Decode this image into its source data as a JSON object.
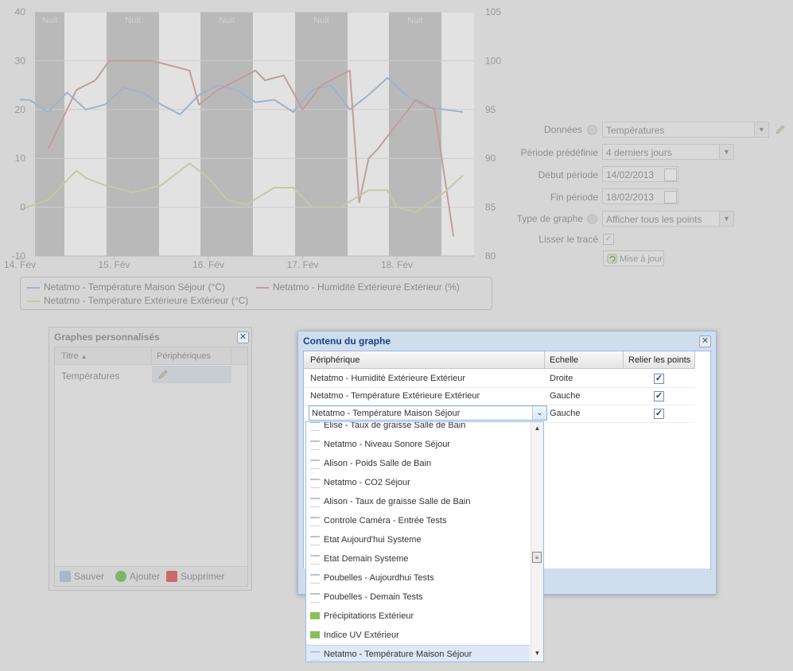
{
  "chart": {
    "left_axis_ticks": [
      "40",
      "30",
      "20",
      "10",
      "0",
      "-10"
    ],
    "right_axis_ticks": [
      "105",
      "100",
      "95",
      "90",
      "85",
      "80"
    ],
    "x_ticks": [
      "14. Fév",
      "15. Fév",
      "16. Fév",
      "17. Fév",
      "18. Fév"
    ],
    "night_label": "Nuit",
    "colors": {
      "maison": "#9fb3c9",
      "humidite": "#c49c9c",
      "exterieur": "#c3c9a6",
      "night": "#b9b9b9",
      "chart_bg": "#e2e2e2"
    }
  },
  "legend": {
    "items": [
      "Netatmo - Température Maison Séjour (°C)",
      "Netatmo - Humidité Extérieure Extérieur (%)",
      "Netatmo - Température Extérieure Extérieur (°C)"
    ]
  },
  "chart_data": {
    "type": "line",
    "title": "",
    "xlabel": "",
    "ylabel": "",
    "x_categories": [
      "14. Fév",
      "15. Fév",
      "16. Fév",
      "17. Fév",
      "18. Fév"
    ],
    "ylim_left": [
      -10,
      40
    ],
    "ylim_right": [
      80,
      105
    ],
    "series": [
      {
        "name": "Netatmo - Température Maison Séjour (°C)",
        "axis": "left",
        "x": [
          0,
          0.1,
          0.3,
          0.5,
          0.7,
          0.9,
          1.1,
          1.3,
          1.5,
          1.7,
          1.9,
          2.1,
          2.3,
          2.5,
          2.7,
          2.9,
          3.1,
          3.3,
          3.5,
          3.7,
          3.9,
          4.1,
          4.3,
          4.5,
          4.7
        ],
        "y": [
          22,
          22,
          19.5,
          23.5,
          20,
          21,
          24.5,
          23.5,
          21,
          19,
          23,
          25,
          24,
          21.5,
          22,
          19.5,
          24,
          25,
          20,
          23,
          26.5,
          23,
          20.5,
          20,
          19.5
        ]
      },
      {
        "name": "Netatmo - Humidité Extérieure Extérieur (%)",
        "axis": "right",
        "x": [
          0.3,
          0.6,
          0.8,
          0.95,
          1.4,
          1.8,
          1.9,
          2.1,
          2.5,
          2.6,
          2.8,
          3.0,
          3.2,
          3.5,
          3.6,
          3.7,
          3.8,
          4.2,
          4.4,
          4.6
        ],
        "y": [
          91,
          97,
          98,
          100,
          100,
          99,
          95.5,
          97,
          99,
          98,
          98.5,
          95,
          97.5,
          99,
          85.5,
          90,
          91,
          96,
          95,
          82
        ]
      },
      {
        "name": "Netatmo - Température Extérieure Extérieur (°C)",
        "axis": "left",
        "x": [
          0,
          0.3,
          0.6,
          0.7,
          0.9,
          1.2,
          1.5,
          1.8,
          2.0,
          2.2,
          2.4,
          2.7,
          2.9,
          3.1,
          3.4,
          3.7,
          3.9,
          4.0,
          4.2,
          4.5,
          4.7
        ],
        "y": [
          -0.5,
          1.5,
          7.5,
          6,
          4.5,
          3,
          4.5,
          9,
          6,
          1.5,
          0.5,
          4,
          4,
          0,
          0,
          3.5,
          3.5,
          0,
          -1,
          3,
          6.5
        ]
      }
    ]
  },
  "form": {
    "donnees_label": "Données",
    "donnees_value": "Températures",
    "periode_label": "Période prédéfinie",
    "periode_value": "4 derniers jours",
    "debut_label": "Début période",
    "debut_value": "14/02/2013",
    "fin_label": "Fin période",
    "fin_value": "18/02/2013",
    "type_label": "Type de graphe",
    "type_value": "Afficher tous les points",
    "lisser_label": "Lisser le tracé",
    "update_label": "Mise à jour"
  },
  "graphes_perso": {
    "title": "Graphes personnalisés",
    "columns": [
      "Titre",
      "Périphériques"
    ],
    "rows": [
      {
        "titre": "Températures"
      }
    ],
    "footer": {
      "save": "Sauver",
      "add": "Ajouter",
      "delete": "Supprimer"
    }
  },
  "contenu": {
    "title": "Contenu du graphe",
    "columns": [
      "Périphérique",
      "Echelle",
      "Relier les points"
    ],
    "rows": [
      {
        "device": "Netatmo - Humidité Extérieure Extérieur",
        "scale": "Droite"
      },
      {
        "device": "Netatmo - Température Extérieure Extérieur",
        "scale": "Gauche"
      },
      {
        "device": "Netatmo - Température Maison Séjour",
        "scale": "Gauche"
      }
    ]
  },
  "dropdown": {
    "items": [
      "Elise - Taux de graisse Salle de Bain",
      "Netatmo - Niveau Sonore Séjour",
      "Alison - Poids Salle de Bain",
      "Netatmo - CO2 Séjour",
      "Alison - Taux de graisse Salle de Bain",
      "Controle Caméra - Entrée Tests",
      "Etat Aujourd'hui Systeme",
      "Etat Demain Systeme",
      "Poubelles - Aujourdhui Tests",
      "Poubelles - Demain Tests",
      "Précipitations Extérieur",
      "Indice UV Extérieur",
      "Netatmo - Température Maison Séjour"
    ],
    "selected_index": 12
  }
}
